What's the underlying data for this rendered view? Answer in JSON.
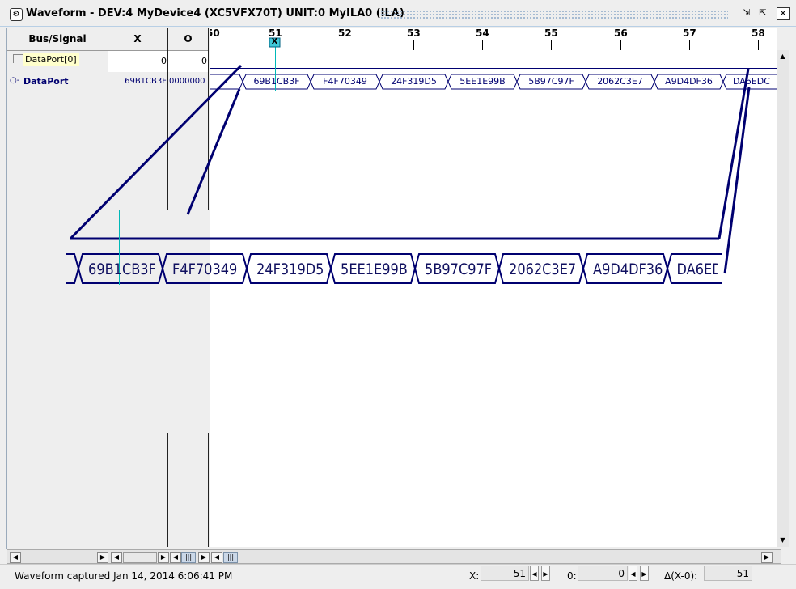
{
  "window": {
    "title": "Waveform - DEV:4 MyDevice4 (XC5VFX70T) UNIT:0 MyILA0 (ILA)",
    "buttons": {
      "restore": "⇲",
      "maximize": "⇱",
      "close": "✕"
    }
  },
  "columns": {
    "signal": "Bus/Signal",
    "x": "X",
    "o": "O"
  },
  "signals": [
    {
      "name": "DataPort[0]",
      "x": "0",
      "o": "0"
    },
    {
      "name": "DataPort",
      "x": "69B1CB3F",
      "o": "0000000"
    }
  ],
  "ruler": {
    "labels": [
      "50",
      "51",
      "52",
      "53",
      "54",
      "55",
      "56",
      "57",
      "58"
    ],
    "cursor_label": "X"
  },
  "bus_values": [
    "69B1CB3F",
    "F4F70349",
    "24F319D5",
    "5EE1E99B",
    "5B97C97F",
    "2062C3E7",
    "A9D4DF36",
    "DA6EDC"
  ],
  "zoom_values": [
    "69B1CB3F",
    "F4F70349",
    "24F319D5",
    "5EE1E99B",
    "5B97C97F",
    "2062C3E7",
    "A9D4DF36",
    "DA6ED"
  ],
  "status": {
    "message": "Waveform captured Jan 14, 2014 6:06:41 PM",
    "x_label": "X:",
    "x_value": "51",
    "o_label": "0:",
    "o_value": "0",
    "delta_label": "Δ(X-0):",
    "delta_value": "51"
  },
  "colors": {
    "bus": "#000070",
    "cursor": "#00b8b8",
    "window_bg": "#eeeeee",
    "border": "#b8cfe5"
  }
}
